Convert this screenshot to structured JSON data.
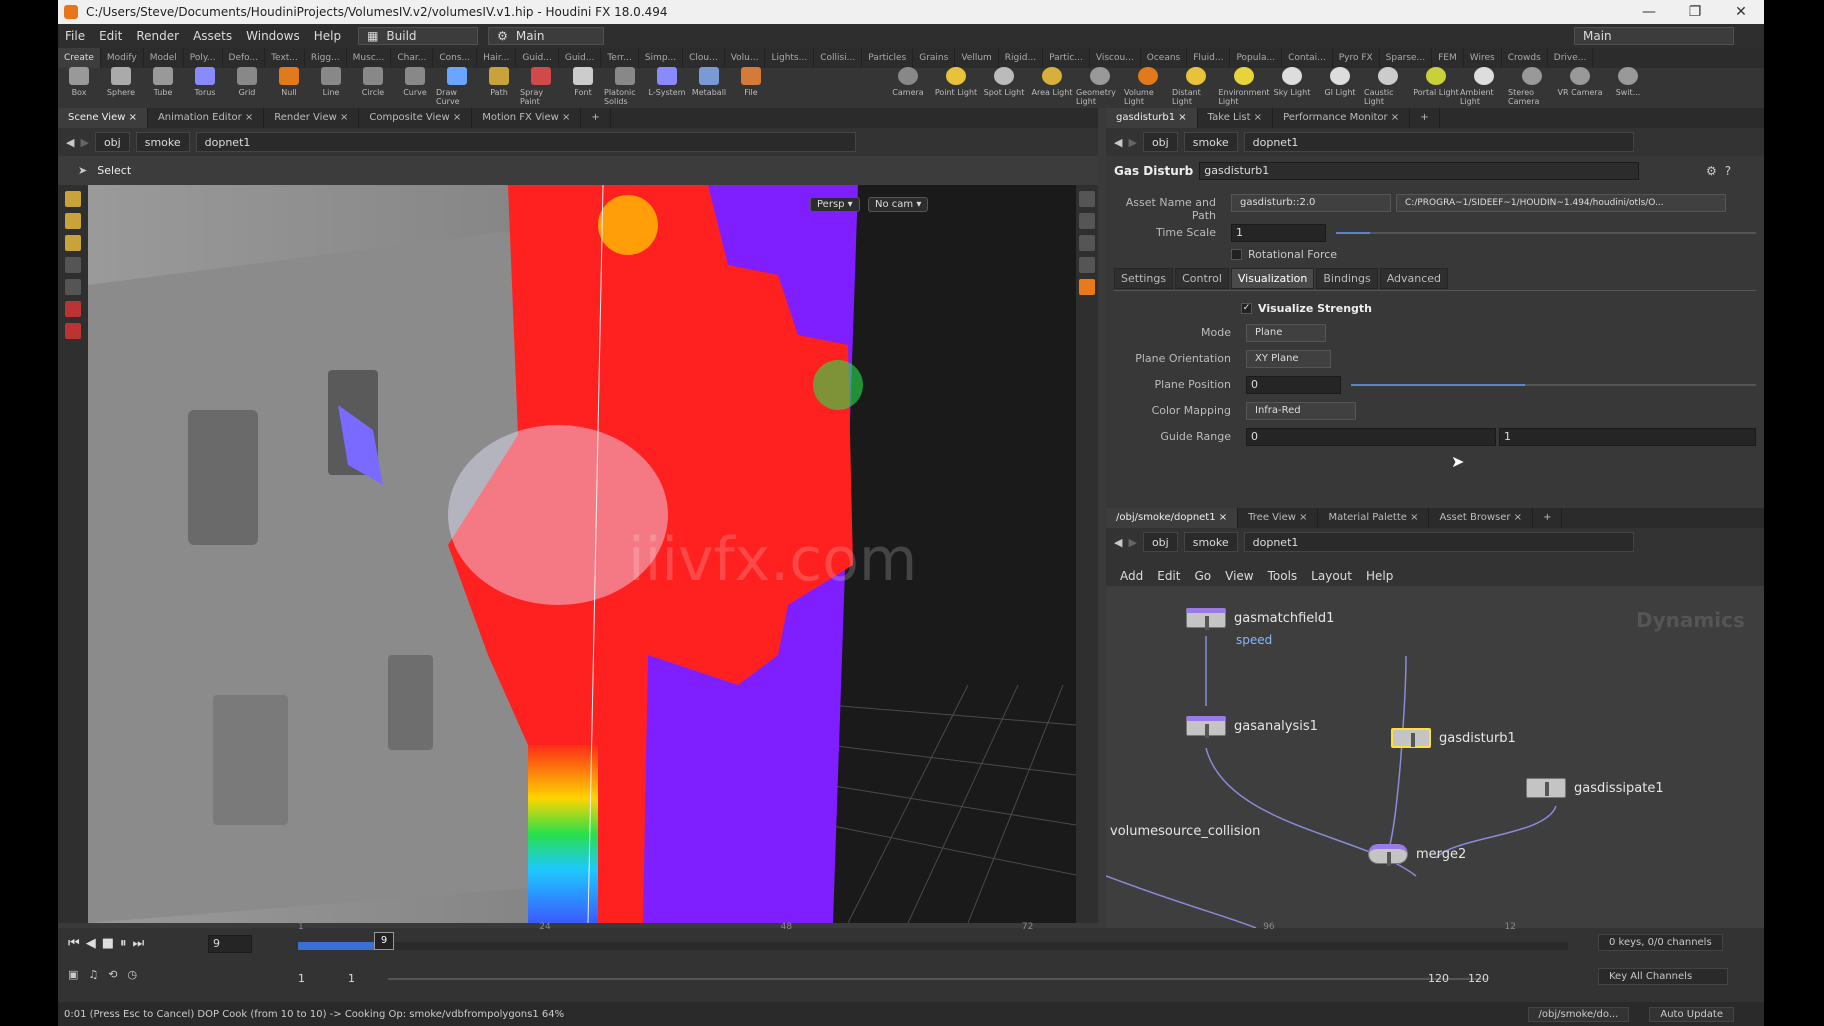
{
  "window": {
    "title": "C:/Users/Steve/Documents/HoudiniProjects/VolumesIV.v2/volumesIV.v1.hip - Houdini FX 18.0.494",
    "controls": [
      "—",
      "❐",
      "✕"
    ]
  },
  "menubar": {
    "items": [
      "File",
      "Edit",
      "Render",
      "Assets",
      "Windows",
      "Help"
    ],
    "desktop": "Build",
    "main": "Main",
    "right": "Main"
  },
  "shelf_tabs": [
    "Create",
    "Modify",
    "Model",
    "Poly...",
    "Defo...",
    "Text...",
    "Rigg...",
    "Musc...",
    "Char...",
    "Cons...",
    "Hair...",
    "Guid...",
    "Guid...",
    "Terr...",
    "Simp...",
    "Clou...",
    "Volu...",
    "Lights...",
    "Collisi...",
    "Particles",
    "Grains",
    "Vellum",
    "Rigid...",
    "Partic...",
    "Viscou...",
    "Oceans",
    "Fluid...",
    "Popula...",
    "Contai...",
    "Pyro FX",
    "Sparse...",
    "FEM",
    "Wires",
    "Crowds",
    "Drive..."
  ],
  "shelf_tools": [
    "Box",
    "Sphere",
    "Tube",
    "Torus",
    "Grid",
    "Null",
    "Line",
    "Circle",
    "Curve",
    "Draw Curve",
    "Path",
    "Spray Paint",
    "Font",
    "Platonic Solids",
    "L-System",
    "Metaball",
    "File"
  ],
  "light_tools": [
    "Camera",
    "Point Light",
    "Spot Light",
    "Area Light",
    "Geometry Light",
    "Volume Light",
    "Distant Light",
    "Environment Light",
    "Sky Light",
    "GI Light",
    "Caustic Light",
    "Portal Light",
    "Ambient Light",
    "Stereo Camera",
    "VR Camera",
    "Swit..."
  ],
  "left_pane_tabs": [
    "Scene View",
    "Animation Editor",
    "Render View",
    "Composite View",
    "Motion FX View"
  ],
  "left_path": [
    "obj",
    "smoke",
    "dopnet1"
  ],
  "viewport": {
    "select_label": "Select",
    "persp": "Persp ▾",
    "cam": "No cam ▾",
    "watermark": "iiivfx.com"
  },
  "param_tabs": [
    "gasdisturb1",
    "Take List",
    "Performance Monitor"
  ],
  "right_path": [
    "obj",
    "smoke",
    "dopnet1"
  ],
  "params": {
    "node_type": "Gas Disturb",
    "node_name": "gasdisturb1",
    "asset_label": "Asset Name and Path",
    "asset_name": "gasdisturb::2.0",
    "asset_path": "C:/PROGRA~1/SIDEEF~1/HOUDIN~1.494/houdini/otls/O...",
    "time_scale_label": "Time Scale",
    "time_scale": "1",
    "rotational_force": "Rotational Force",
    "tabs": [
      "Settings",
      "Control",
      "Visualization",
      "Bindings",
      "Advanced"
    ],
    "visualize_strength": "Visualize Strength",
    "mode_label": "Mode",
    "mode": "Plane",
    "plane_orient_label": "Plane Orientation",
    "plane_orient": "XY Plane",
    "plane_pos_label": "Plane Position",
    "plane_pos": "0",
    "color_map_label": "Color Mapping",
    "color_map": "Infra-Red",
    "guide_range_label": "Guide Range",
    "guide_min": "0",
    "guide_max": "1"
  },
  "net_tabs": [
    "/obj/smoke/dopnet1",
    "Tree View",
    "Material Palette",
    "Asset Browser"
  ],
  "net_path": [
    "obj",
    "smoke",
    "dopnet1"
  ],
  "net_menu": [
    "Add",
    "Edit",
    "Go",
    "View",
    "Tools",
    "Layout",
    "Help"
  ],
  "net_context": "Dynamics",
  "nodes": {
    "gasmatchfield": "gasmatchfield1",
    "speed": "speed",
    "gasanalysis": "gasanalysis1",
    "gasdisturb": "gasdisturb1",
    "gasdissipate": "gasdissipate1",
    "volumesource": "volumesource_collision",
    "merge": "merge2"
  },
  "timeline": {
    "frame": "9",
    "current": "9",
    "ticks": [
      "1",
      "24",
      "48",
      "72",
      "96",
      "12"
    ],
    "start": "1",
    "start2": "1",
    "end": "120",
    "end2": "120",
    "keys": "0 keys, 0/0 channels",
    "key_all": "Key All Channels"
  },
  "status": {
    "text": "0:01 (Press Esc to Cancel) DOP Cook (from 10 to 10) -> Cooking Op: smoke/vdbfrompolygons1 64%",
    "path": "/obj/smoke/do...",
    "update": "Auto Update"
  }
}
